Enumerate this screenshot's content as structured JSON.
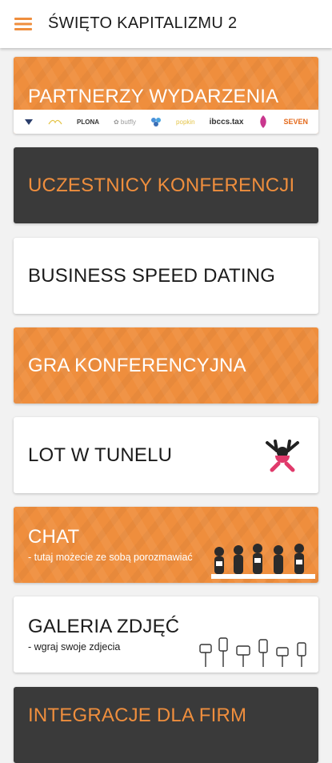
{
  "header": {
    "title": "ŚWIĘTO KAPITALIZMU 2",
    "menu_icon": "hamburger-menu-icon"
  },
  "colors": {
    "accent": "#ef8e3d",
    "dark_card": "#3a3a3a",
    "white_card": "#ffffff",
    "background": "#f2f2f2"
  },
  "tiles": [
    {
      "label": "PARTNERZY WYDARZENIA",
      "style": "orange",
      "partner_logos": [
        "EyeShield",
        "Nedrzalek",
        "PLONA",
        "Butterfly",
        "Kuk-Studio",
        "popkin",
        "ibccs.tax",
        "Lotus",
        "SEVEN"
      ]
    },
    {
      "label": "UCZESTNICY KONFERENCJI",
      "style": "dark"
    },
    {
      "label": "BUSINESS SPEED DATING",
      "style": "white"
    },
    {
      "label": "GRA KONFERENCYJNA",
      "style": "orange"
    },
    {
      "label": "LOT W TUNELU",
      "style": "white",
      "icon": "skydiver-icon"
    },
    {
      "label": "CHAT",
      "subtitle": "- tutaj możecie ze sobą porozmawiać",
      "style": "orange"
    },
    {
      "label": "GALERIA ZDJĘĆ",
      "subtitle": "- wgraj swoje zdjecia",
      "style": "white"
    },
    {
      "label": "INTEGRACJE DLA FIRM",
      "style": "dark"
    }
  ]
}
